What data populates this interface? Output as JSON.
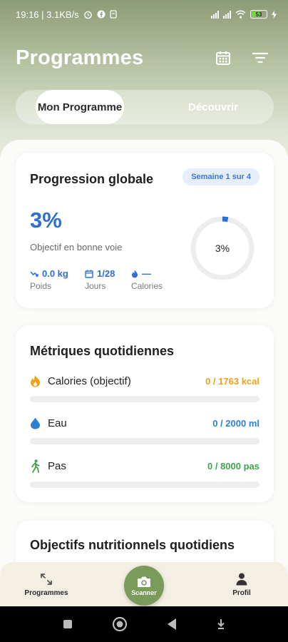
{
  "status_bar": {
    "time_and_speed": "19:16 | 3.1KB/s",
    "battery": "53"
  },
  "header": {
    "title": "Programmes"
  },
  "tabs": [
    {
      "label": "Mon Programme",
      "active": true
    },
    {
      "label": "Découvrir",
      "active": false
    }
  ],
  "progress_card": {
    "title": "Progression globale",
    "week_badge": "Semaine 1 sur 4",
    "percent_text": "3%",
    "percent_value": 3,
    "status": "Objectif en bonne voie",
    "ring_label": "3%",
    "stats": [
      {
        "value": "0.0 kg",
        "label": "Poids",
        "icon": "trend-icon"
      },
      {
        "value": "1/28",
        "label": "Jours",
        "icon": "calendar-icon"
      },
      {
        "value": "—",
        "label": "Calories",
        "icon": "flame-icon"
      }
    ]
  },
  "metrics_card": {
    "title": "Métriques quotidiennes",
    "items": [
      {
        "label": "Calories (objectif)",
        "value": "0 / 1763 kcal",
        "progress": 0,
        "color": "#f0a020",
        "icon": "flame-icon"
      },
      {
        "label": "Eau",
        "value": "0 / 2000 ml",
        "progress": 0,
        "color": "#2d7fd6",
        "icon": "water-drop-icon"
      },
      {
        "label": "Pas",
        "value": "0 / 8000 pas",
        "progress": 0,
        "color": "#3fa34d",
        "icon": "walk-icon"
      }
    ]
  },
  "nutrition_card": {
    "title": "Objectifs nutritionnels quotidiens"
  },
  "bottom_nav": {
    "programmes": "Programmes",
    "scanner": "Scanner",
    "profil": "Profil"
  },
  "colors": {
    "accent_blue": "#2f6fcf",
    "brand_green": "#7a9b59"
  }
}
